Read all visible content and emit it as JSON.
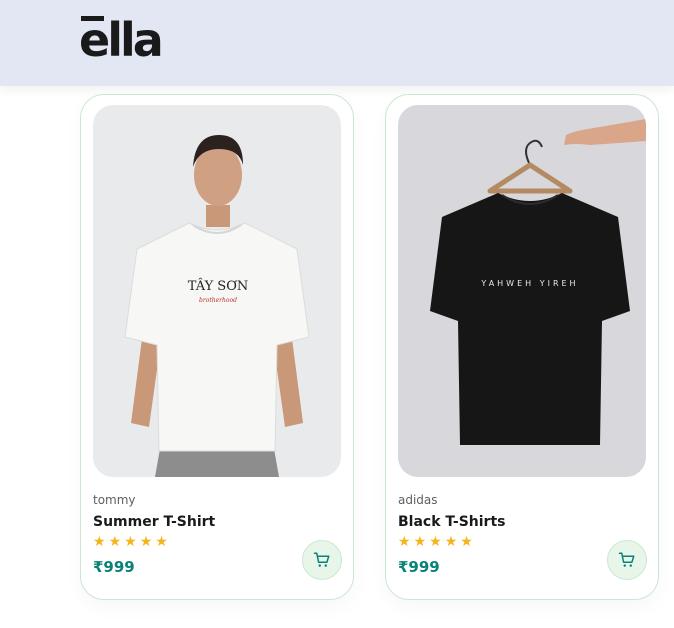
{
  "header": {
    "logo_text": "ella"
  },
  "products": [
    {
      "brand": "tommy",
      "title": "Summer T-Shirt",
      "rating": 5,
      "price": "₹999",
      "shirt_print": "TÂY SƠN",
      "shirt_subprint": "brotherhood",
      "icon": "cart-icon"
    },
    {
      "brand": "adidas",
      "title": "Black T-Shirts",
      "rating": 5,
      "price": "₹999",
      "shirt_print": "YAHWEH YIREH",
      "icon": "cart-icon"
    }
  ],
  "colors": {
    "header_bg": "#e3e6f3",
    "accent": "#088178",
    "star": "#f3b519",
    "card_border": "#cce7d0"
  }
}
